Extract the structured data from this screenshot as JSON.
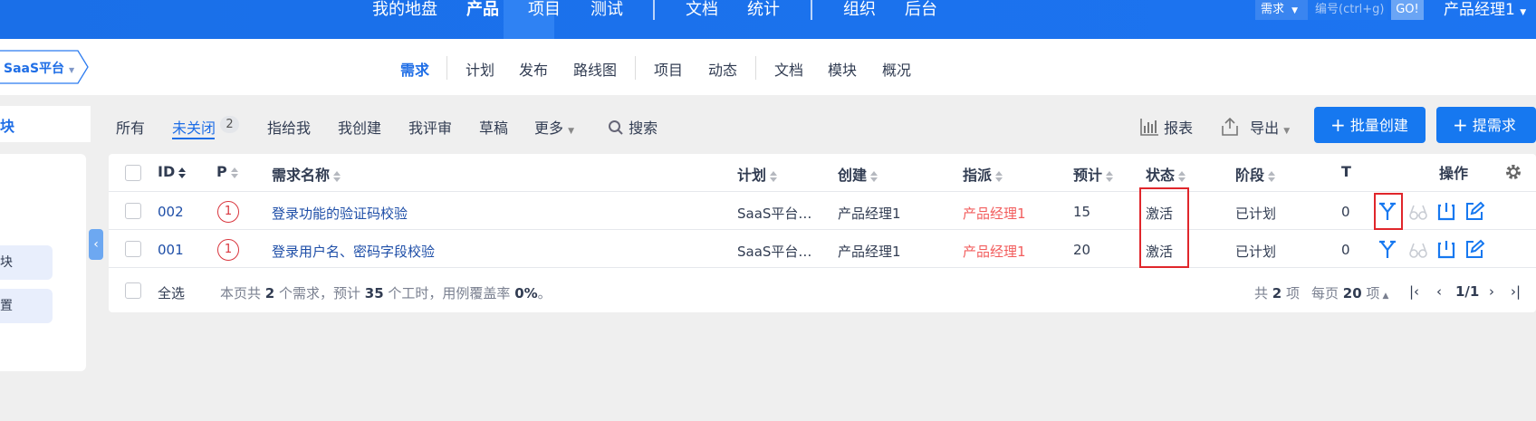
{
  "top_nav": {
    "items": [
      "我的地盘",
      "产品",
      "项目",
      "测试",
      "文档",
      "统计",
      "组织",
      "后台"
    ],
    "active": "产品",
    "search_type": "需求",
    "search_placeholder": "编号(ctrl+g)",
    "go_label": "GO!",
    "user": "产品经理1"
  },
  "product_selector": "SaaS平台",
  "sub_nav": [
    "需求",
    "计划",
    "发布",
    "路线图",
    "项目",
    "动态",
    "文档",
    "模块",
    "概况"
  ],
  "sub_nav_active": "需求",
  "left_sidebar": {
    "module_tab": "块",
    "buttons": [
      "块",
      "置"
    ]
  },
  "filter_tabs": [
    "所有",
    "未关闭",
    "指给我",
    "我创建",
    "我评审",
    "草稿",
    "更多"
  ],
  "filter_active": "未关闭",
  "filter_count": "2",
  "search_label": "搜索",
  "toolbar": {
    "report": "报表",
    "export": "导出",
    "batch_create": "批量创建",
    "create": "提需求"
  },
  "table": {
    "headers": {
      "id": "ID",
      "pri": "P",
      "title": "需求名称",
      "plan": "计划",
      "creator": "创建",
      "assignee": "指派",
      "estimate": "预计",
      "status": "状态",
      "stage": "阶段",
      "t": "T",
      "actions": "操作"
    },
    "rows": [
      {
        "id": "002",
        "pri": "1",
        "title": "登录功能的验证码校验",
        "plan": "SaaS平台…",
        "creator": "产品经理1",
        "assignee": "产品经理1",
        "estimate": "15",
        "status": "激活",
        "stage": "已计划",
        "t": "0"
      },
      {
        "id": "001",
        "pri": "1",
        "title": "登录用户名、密码字段校验",
        "plan": "SaaS平台…",
        "creator": "产品经理1",
        "assignee": "产品经理1",
        "estimate": "20",
        "status": "激活",
        "stage": "已计划",
        "t": "0"
      }
    ]
  },
  "footer": {
    "select_all": "全选",
    "summary_a": "本页共 ",
    "summary_b": "2",
    "summary_c": " 个需求，预计 ",
    "summary_d": "35",
    "summary_e": " 个工时，用例覆盖率 ",
    "summary_f": "0%",
    "summary_g": "。",
    "total_a": "共 ",
    "total_b": "2",
    "total_c": " 项",
    "per_page_a": "每页 ",
    "per_page_b": "20",
    "per_page_c": " 项",
    "page": "1/1"
  },
  "colors": {
    "primary": "#1678f0",
    "link": "#1f6ee6",
    "assignee": "#f25d5d",
    "highlight_box": "#e0262b"
  }
}
